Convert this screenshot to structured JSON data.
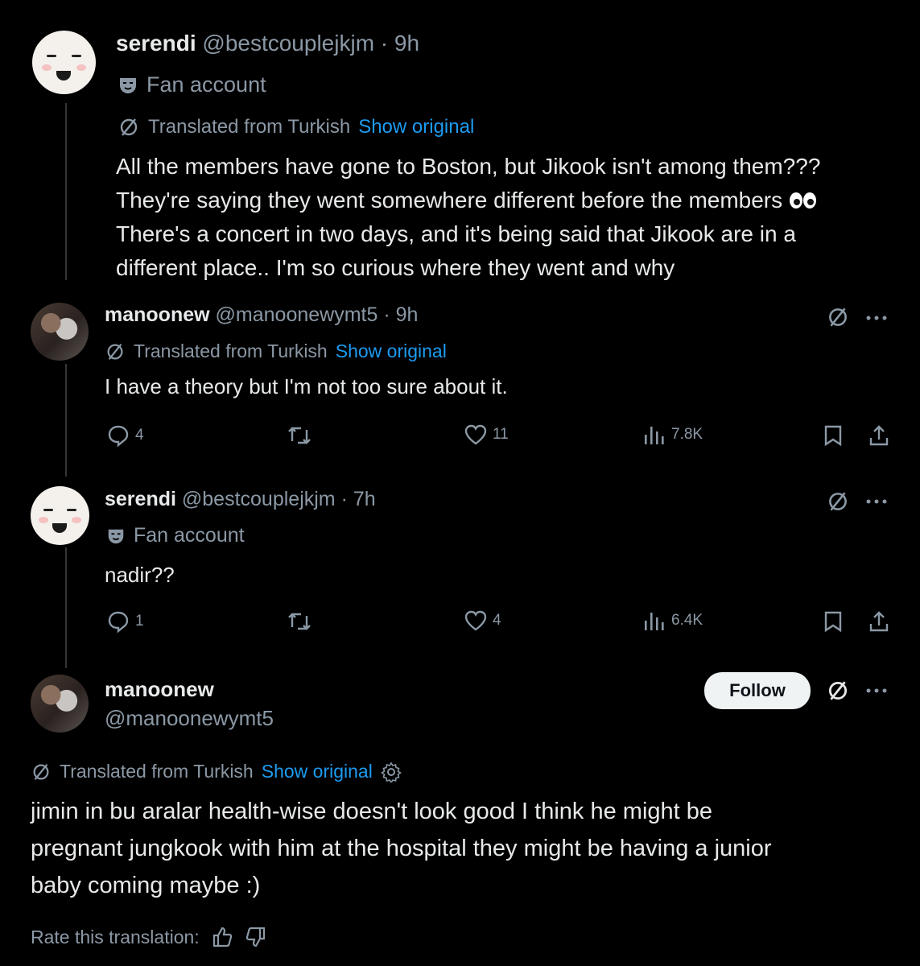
{
  "thread": {
    "tweet1": {
      "name": "serendi",
      "handle": "@bestcouplejkjm",
      "time": "· 9h",
      "label": "Fan account",
      "translated": "Translated from Turkish",
      "show_original": "Show original",
      "lines": [
        "All the members have gone to Boston, but Jikook isn't among them???",
        "They're saying they went somewhere different before the members",
        "There's a concert in two days, and it's being said that Jikook are in a",
        "different place.. I'm so curious where they went and why"
      ]
    },
    "tweet2": {
      "name": "manoonew",
      "handle": "@manoonewymt5",
      "time": "· 9h",
      "translated": "Translated from Turkish",
      "show_original": "Show original",
      "text": "I have a theory but I'm not too sure about it.",
      "replies": "4",
      "likes": "11",
      "views": "7.8K"
    },
    "tweet3": {
      "name": "serendi",
      "handle": "@bestcouplejkjm",
      "time": "· 7h",
      "label": "Fan account",
      "text": "nadir??",
      "replies": "1",
      "likes": "4",
      "views": "6.4K"
    },
    "tweet4": {
      "name": "manoonew",
      "handle": "@manoonewymt5",
      "follow": "Follow",
      "translated": "Translated from Turkish",
      "show_original": "Show original",
      "lines": [
        "jimin in bu aralar health-wise doesn't look good I think he might be",
        "pregnant jungkook with him at the hospital they might be having a junior",
        "baby coming maybe :)"
      ],
      "rate": "Rate this translation:"
    }
  },
  "colors": {
    "background": "#000000",
    "text": "#e7e9ea",
    "muted": "#8b98a5",
    "link": "#1d9bf0"
  }
}
